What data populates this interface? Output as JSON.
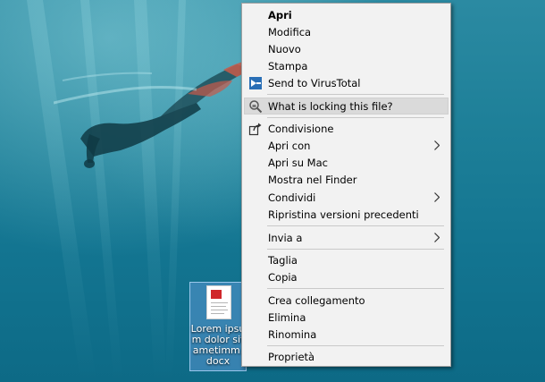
{
  "desktop_file": {
    "label": "Lorem ipsum dolor sit ametimm.docx",
    "icon": "word-document-icon"
  },
  "context_menu": {
    "items": [
      {
        "label": "Apri",
        "bold": true
      },
      {
        "label": "Modifica"
      },
      {
        "label": "Nuovo"
      },
      {
        "label": "Stampa"
      },
      {
        "label": "Send to VirusTotal",
        "icon": "virustotal-icon"
      },
      {
        "label": "What is locking this file?",
        "icon": "lock-search-icon",
        "highlighted": true
      },
      {
        "label": "Condivisione",
        "icon": "share-icon"
      },
      {
        "label": "Apri con",
        "submenu": true
      },
      {
        "label": "Apri su Mac"
      },
      {
        "label": "Mostra nel Finder"
      },
      {
        "label": "Condividi",
        "submenu": true
      },
      {
        "label": "Ripristina versioni precedenti"
      },
      {
        "label": "Invia a",
        "submenu": true
      },
      {
        "label": "Taglia"
      },
      {
        "label": "Copia"
      },
      {
        "label": "Crea collegamento"
      },
      {
        "label": "Elimina"
      },
      {
        "label": "Rinomina"
      },
      {
        "label": "Proprietà"
      }
    ]
  },
  "colors": {
    "menu_bg": "#f2f2f2",
    "highlight": "#dadada",
    "selection": "#5a96d2"
  }
}
